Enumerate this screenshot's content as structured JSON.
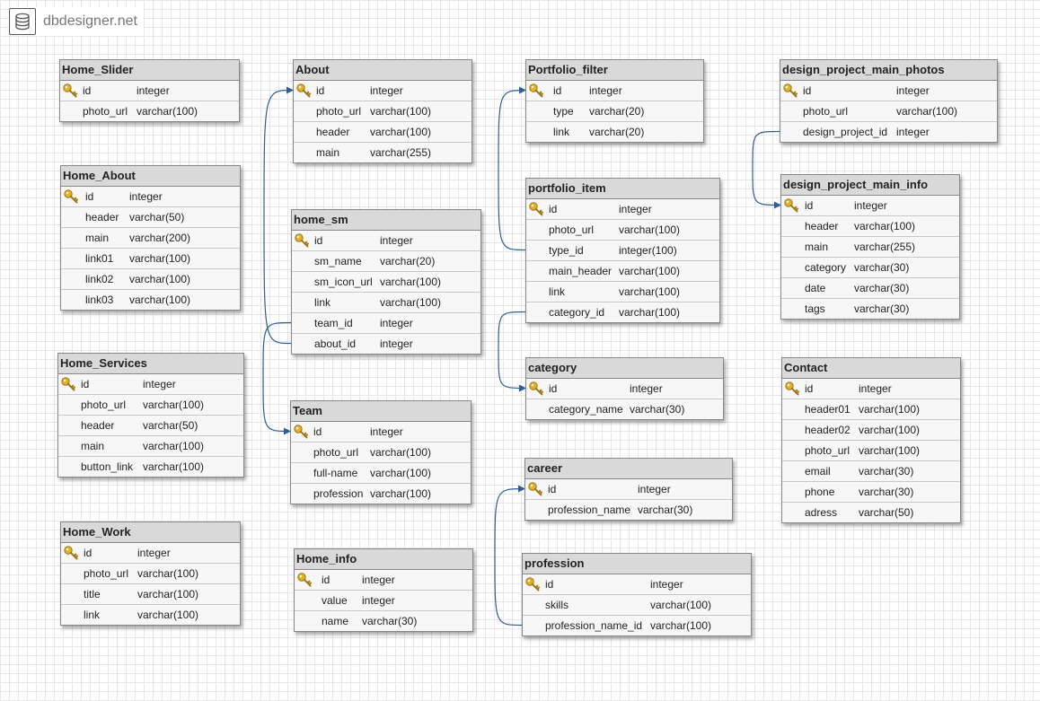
{
  "brand": {
    "name": "dbdesigner.net",
    "icon": "database-icon"
  },
  "tables": [
    {
      "id": "Home_Slider",
      "name": "Home_Slider",
      "rows": [
        {
          "name": "id",
          "type": "integer",
          "pk": true
        },
        {
          "name": "photo_url",
          "type": "varchar(100)"
        }
      ]
    },
    {
      "id": "Home_About",
      "name": "Home_About",
      "rows": [
        {
          "name": "id",
          "type": "integer",
          "pk": true
        },
        {
          "name": "header",
          "type": "varchar(50)"
        },
        {
          "name": "main",
          "type": "varchar(200)"
        },
        {
          "name": "link01",
          "type": "varchar(100)"
        },
        {
          "name": "link02",
          "type": "varchar(100)"
        },
        {
          "name": "link03",
          "type": "varchar(100)"
        }
      ]
    },
    {
      "id": "Home_Services",
      "name": "Home_Services",
      "rows": [
        {
          "name": "id",
          "type": "integer",
          "pk": true
        },
        {
          "name": "photo_url",
          "type": "varchar(100)"
        },
        {
          "name": "header",
          "type": "varchar(50)"
        },
        {
          "name": "main",
          "type": "varchar(100)"
        },
        {
          "name": "button_link",
          "type": "varchar(100)"
        }
      ]
    },
    {
      "id": "Home_Work",
      "name": "Home_Work",
      "rows": [
        {
          "name": "id",
          "type": "integer",
          "pk": true
        },
        {
          "name": "photo_url",
          "type": "varchar(100)"
        },
        {
          "name": "title",
          "type": "varchar(100)"
        },
        {
          "name": "link",
          "type": "varchar(100)"
        }
      ]
    },
    {
      "id": "About",
      "name": "About",
      "rows": [
        {
          "name": "id",
          "type": "integer",
          "pk": true
        },
        {
          "name": "photo_url",
          "type": "varchar(100)"
        },
        {
          "name": "header",
          "type": "varchar(100)"
        },
        {
          "name": "main",
          "type": "varchar(255)"
        }
      ]
    },
    {
      "id": "home_sm",
      "name": "home_sm",
      "rows": [
        {
          "name": "id",
          "type": "integer",
          "pk": true
        },
        {
          "name": "sm_name",
          "type": "varchar(20)"
        },
        {
          "name": "sm_icon_url",
          "type": "varchar(100)"
        },
        {
          "name": "link",
          "type": "varchar(100)"
        },
        {
          "name": "team_id",
          "type": "integer"
        },
        {
          "name": "about_id",
          "type": "integer"
        }
      ]
    },
    {
      "id": "Team",
      "name": "Team",
      "rows": [
        {
          "name": "id",
          "type": "integer",
          "pk": true
        },
        {
          "name": "photo_url",
          "type": "varchar(100)"
        },
        {
          "name": "full-name",
          "type": "varchar(100)"
        },
        {
          "name": "profession",
          "type": "varchar(100)"
        }
      ]
    },
    {
      "id": "Home_info",
      "name": "Home_info",
      "rows": [
        {
          "name": "id",
          "type": "integer",
          "pk": true
        },
        {
          "name": "value",
          "type": "integer"
        },
        {
          "name": "name",
          "type": "varchar(30)"
        }
      ]
    },
    {
      "id": "Portfolio_filter",
      "name": "Portfolio_filter",
      "rows": [
        {
          "name": "id",
          "type": "integer",
          "pk": true
        },
        {
          "name": "type",
          "type": "varchar(20)"
        },
        {
          "name": "link",
          "type": "varchar(20)"
        }
      ]
    },
    {
      "id": "portfolio_item",
      "name": "portfolio_item",
      "rows": [
        {
          "name": "id",
          "type": "integer",
          "pk": true
        },
        {
          "name": "photo_url",
          "type": "varchar(100)"
        },
        {
          "name": "type_id",
          "type": "integer(100)"
        },
        {
          "name": "main_header",
          "type": "varchar(100)"
        },
        {
          "name": "link",
          "type": "varchar(100)"
        },
        {
          "name": "category_id",
          "type": "varchar(100)"
        }
      ]
    },
    {
      "id": "category",
      "name": "category",
      "rows": [
        {
          "name": "id",
          "type": "integer",
          "pk": true
        },
        {
          "name": "category_name",
          "type": "varchar(30)"
        }
      ]
    },
    {
      "id": "career",
      "name": "career",
      "rows": [
        {
          "name": "id",
          "type": "integer",
          "pk": true
        },
        {
          "name": "profession_name",
          "type": "varchar(30)"
        }
      ]
    },
    {
      "id": "profession",
      "name": "profession",
      "rows": [
        {
          "name": "id",
          "type": "integer",
          "pk": true
        },
        {
          "name": "skills",
          "type": "varchar(100)"
        },
        {
          "name": "profession_name_id",
          "type": "varchar(100)"
        }
      ]
    },
    {
      "id": "design_project_main_photos",
      "name": "design_project_main_photos",
      "rows": [
        {
          "name": "id",
          "type": "integer",
          "pk": true
        },
        {
          "name": "photo_url",
          "type": "varchar(100)"
        },
        {
          "name": "design_project_id",
          "type": "integer"
        }
      ]
    },
    {
      "id": "design_project_main_info",
      "name": "design_project_main_info",
      "rows": [
        {
          "name": "id",
          "type": "integer",
          "pk": true
        },
        {
          "name": "header",
          "type": "varchar(100)"
        },
        {
          "name": "main",
          "type": "varchar(255)"
        },
        {
          "name": "category",
          "type": "varchar(30)"
        },
        {
          "name": "date",
          "type": "varchar(30)"
        },
        {
          "name": "tags",
          "type": "varchar(30)"
        }
      ]
    },
    {
      "id": "Contact",
      "name": "Contact",
      "rows": [
        {
          "name": "id",
          "type": "integer",
          "pk": true
        },
        {
          "name": "header01",
          "type": "varchar(100)"
        },
        {
          "name": "header02",
          "type": "varchar(100)"
        },
        {
          "name": "photo_url",
          "type": "varchar(100)"
        },
        {
          "name": "email",
          "type": "varchar(30)"
        },
        {
          "name": "phone",
          "type": "varchar(30)"
        },
        {
          "name": "adress",
          "type": "varchar(50)"
        }
      ]
    }
  ],
  "relations": [
    {
      "from": "home_sm.about_id",
      "to": "About.id"
    },
    {
      "from": "home_sm.team_id",
      "to": "Team.id"
    },
    {
      "from": "portfolio_item.type_id",
      "to": "Portfolio_filter.id"
    },
    {
      "from": "portfolio_item.category_id",
      "to": "category.id"
    },
    {
      "from": "profession.profession_name_id",
      "to": "career.id"
    },
    {
      "from": "design_project_main_photos.design_project_id",
      "to": "design_project_main_info.id"
    }
  ],
  "colors": {
    "header_bg": "#d9d9d9",
    "body_bg": "#f7f7f7",
    "border": "#888888",
    "connector": "#2f5f93",
    "key_gold": "#e0b12a",
    "grid": "#e6e6e6"
  },
  "key_icon": "primary-key-icon"
}
